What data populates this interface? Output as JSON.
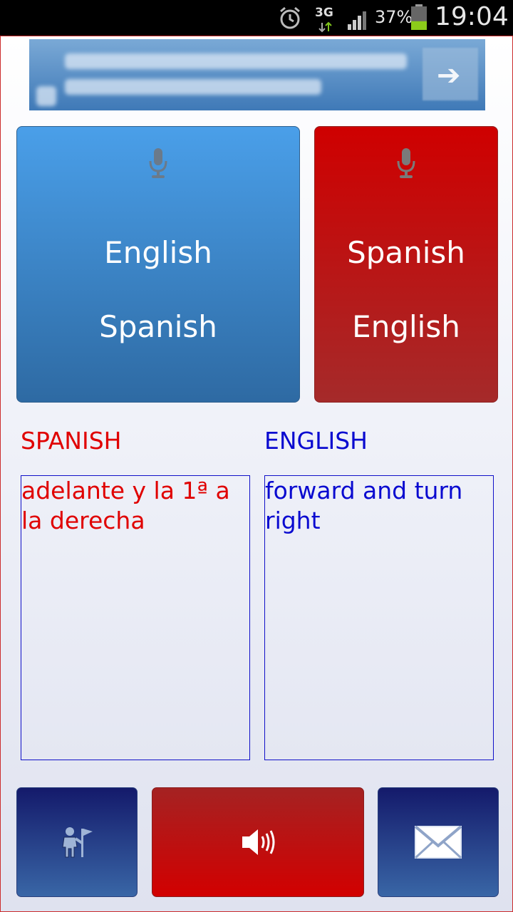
{
  "status_bar": {
    "network": "3G",
    "battery_percent": "37%",
    "battery_level": 0.37,
    "time": "19:04",
    "icons": [
      "alarm-icon",
      "data-arrows-icon",
      "signal-icon",
      "battery-icon"
    ]
  },
  "buttons": {
    "english_to_spanish": {
      "line1": "English",
      "line2": "Spanish",
      "icon": "microphone-icon"
    },
    "spanish_to_english": {
      "line1": "Spanish",
      "line2": "English",
      "icon": "microphone-icon"
    }
  },
  "panels": {
    "spanish": {
      "label": "SPANISH",
      "text": "adelante y la 1ª a la derecha"
    },
    "english": {
      "label": "ENGLISH",
      "text": "forward and turn right"
    }
  },
  "bottom_bar": {
    "icons": [
      "guide-icon",
      "speaker-icon",
      "email-icon"
    ]
  },
  "colors": {
    "blue_button": "#3a84cc",
    "red_button": "#c01010",
    "spanish_text": "#e00000",
    "english_text": "#0a0ad0",
    "navy_button": "#1f2f80"
  }
}
